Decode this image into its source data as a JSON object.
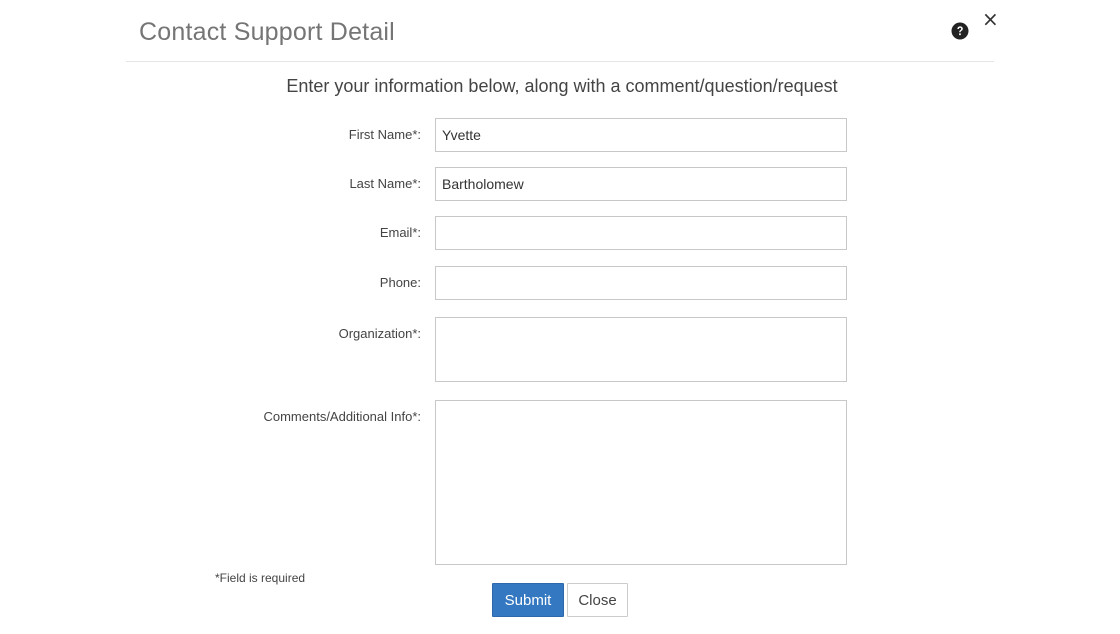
{
  "modal": {
    "title": "Contact Support Detail",
    "help_icon": "question-circle-icon",
    "close_icon": "close-icon",
    "close_glyph": "×"
  },
  "form": {
    "intro": "Enter your information below, along with a comment/question/request",
    "fields": {
      "first_name": {
        "label": "First Name*:",
        "value": "Yvette"
      },
      "last_name": {
        "label": "Last Name*:",
        "value": "Bartholomew"
      },
      "email": {
        "label": "Email*:",
        "value": ""
      },
      "phone": {
        "label": "Phone:",
        "value": ""
      },
      "organization": {
        "label": "Organization*:",
        "value": ""
      },
      "comments": {
        "label": "Comments/Additional Info*:",
        "value": ""
      }
    },
    "required_note": "*Field is required",
    "submit_label": "Submit",
    "close_label": "Close"
  },
  "colors": {
    "primary": "#3378c0",
    "title": "#757575",
    "border": "#c8c8c8"
  }
}
